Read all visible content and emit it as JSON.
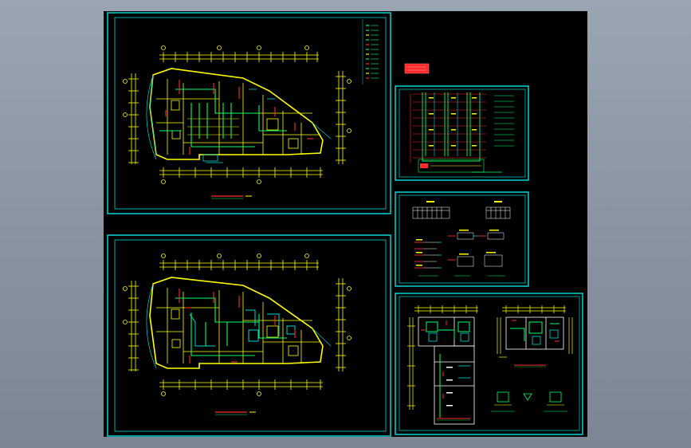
{
  "colors": {
    "background_top": "#9aa5b2",
    "background_bottom": "#7b8594",
    "canvas": "#000000",
    "sheet_border": "#00d6d6",
    "wall": "#ffff00",
    "pipe_green": "#00ff66",
    "pipe_red": "#ff2a2a",
    "text_yellow": "#ffff33"
  },
  "sheets": {
    "plan_upper": "plan-upper",
    "plan_lower": "plan-lower",
    "riser_diagram": "riser-diagram",
    "detail_sheet": "detail-sheet",
    "enlarged_plan": "enlarged-plan"
  },
  "icons": {
    "title_stamp": "title-stamp-icon"
  }
}
